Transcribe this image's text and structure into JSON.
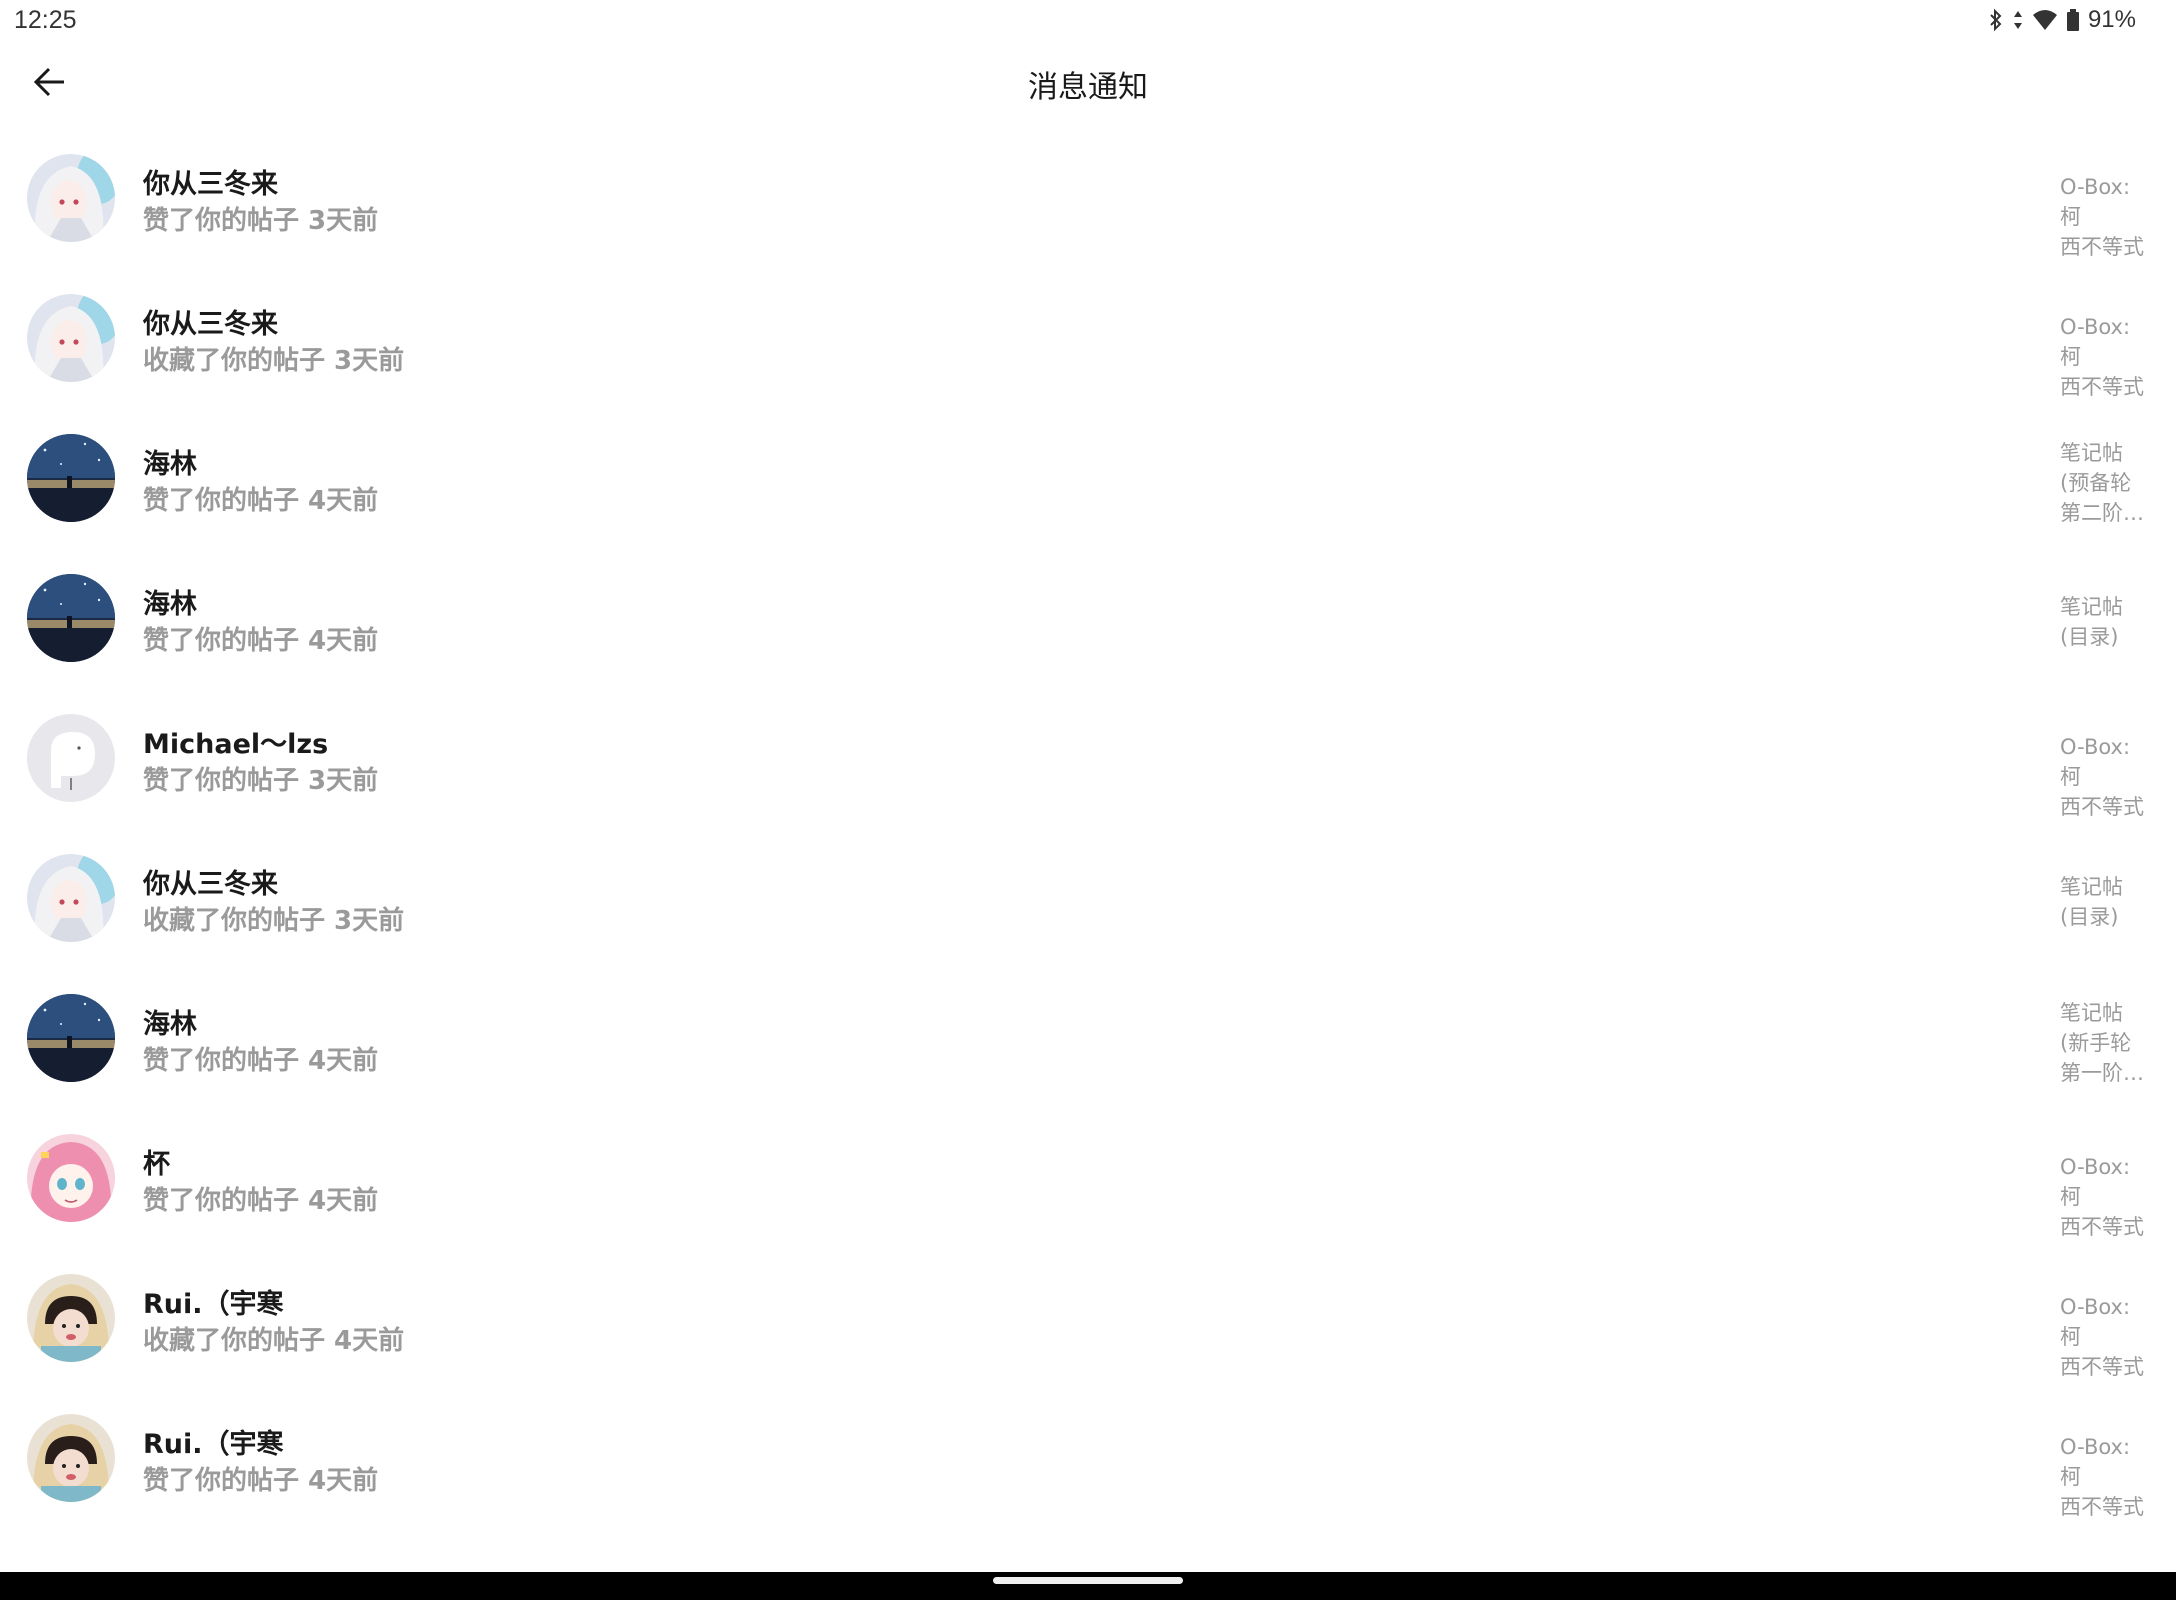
{
  "status_bar": {
    "time": "12:25",
    "battery": "91%"
  },
  "header": {
    "title": "消息通知"
  },
  "notifications": [
    {
      "name": "你从三冬来",
      "action": "赞了你的帖子 3天前",
      "post": "O-Box:柯\n西不等式",
      "avatar": "anime-girl-white-hair"
    },
    {
      "name": "你从三冬来",
      "action": "收藏了你的帖子 3天前",
      "post": "O-Box:柯\n西不等式",
      "avatar": "anime-girl-white-hair"
    },
    {
      "name": "海林",
      "action": "赞了你的帖子 4天前",
      "post": "笔记帖\n(预备轮\n第二阶…",
      "avatar": "night-sky-landscape"
    },
    {
      "name": "海林",
      "action": "赞了你的帖子 4天前",
      "post": "笔记帖\n(目录)",
      "avatar": "night-sky-landscape"
    },
    {
      "name": "Michael～lzs",
      "action": "赞了你的帖子 3天前",
      "post": "O-Box:柯\n西不等式",
      "avatar": "default-avatar"
    },
    {
      "name": "你从三冬来",
      "action": "收藏了你的帖子 3天前",
      "post": "笔记帖\n(目录)",
      "avatar": "anime-girl-white-hair"
    },
    {
      "name": "海林",
      "action": "赞了你的帖子 4天前",
      "post": "笔记帖\n(新手轮\n第一阶…",
      "avatar": "night-sky-landscape"
    },
    {
      "name": "杯",
      "action": "赞了你的帖子 4天前",
      "post": "O-Box:柯\n西不等式",
      "avatar": "anime-girl-pink-hair"
    },
    {
      "name": "Rui.（宇寒",
      "action": "收藏了你的帖子 4天前",
      "post": "O-Box:柯\n西不等式",
      "avatar": "girl-photo"
    },
    {
      "name": "Rui.（宇寒",
      "action": "赞了你的帖子 4天前",
      "post": "O-Box:柯\n西不等式",
      "avatar": "girl-photo"
    }
  ],
  "partial_item": {
    "name": "...",
    "avatar": "none"
  },
  "colors": {
    "title_text": "#1a1a1a",
    "secondary_text": "#9a9a9a",
    "background": "#ffffff",
    "nav_bar": "#000000"
  }
}
